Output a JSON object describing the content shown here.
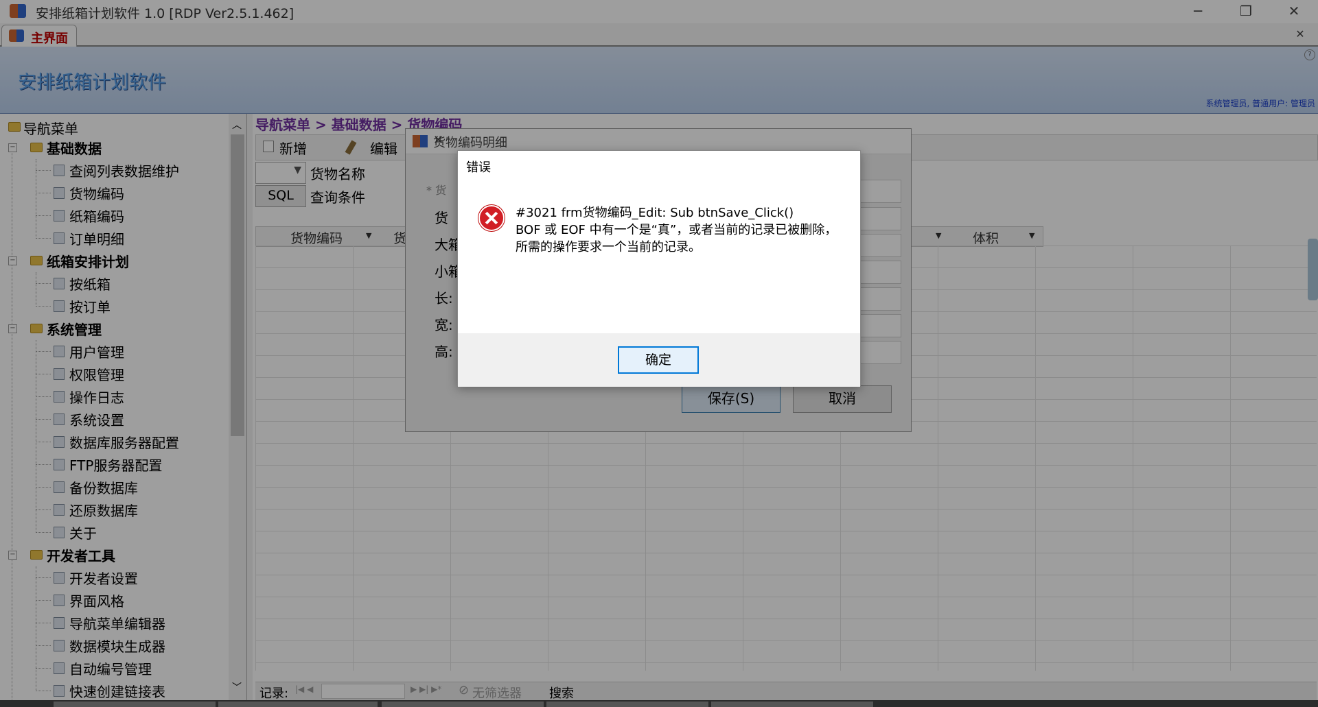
{
  "window": {
    "title": "安排纸箱计划软件 1.0 [RDP Ver2.5.1.462]",
    "minimize_glyph": "─",
    "maximize_glyph": "❐",
    "close_glyph": "✕"
  },
  "tabs": {
    "main_tab": "主界面",
    "close_glyph": "✕"
  },
  "banner": {
    "app_name": "安排纸箱计划软件",
    "user_info": "系统管理员, 普通用户: 管理员",
    "help_glyph": "?"
  },
  "sidebar": {
    "root": "导航菜单",
    "groups": [
      {
        "label": "基础数据",
        "items": [
          "查阅列表数据维护",
          "货物编码",
          "纸箱编码",
          "订单明细"
        ]
      },
      {
        "label": "纸箱安排计划",
        "items": [
          "按纸箱",
          "按订单"
        ]
      },
      {
        "label": "系统管理",
        "items": [
          "用户管理",
          "权限管理",
          "操作日志",
          "系统设置",
          "数据库服务器配置",
          "FTP服务器配置",
          "备份数据库",
          "还原数据库",
          "关于"
        ]
      },
      {
        "label": "开发者工具",
        "items": [
          "开发者设置",
          "界面风格",
          "导航菜单编辑器",
          "数据模块生成器",
          "自动编号管理",
          "快速创建链接表"
        ]
      }
    ]
  },
  "content": {
    "breadcrumb": "导航菜单 > 基础数据 > 货物编码",
    "toolbar": {
      "new_label": "新增",
      "edit_label": "编辑"
    },
    "filter": {
      "field_label": "货物名称",
      "sql_label": "SQL",
      "condition_label": "查询条件"
    },
    "grid": {
      "columns": [
        "货物编码",
        "货",
        "体积"
      ]
    },
    "navigator": {
      "record_label": "记录:",
      "no_filter": "无筛选器",
      "search_label": "搜索"
    }
  },
  "detail_dialog": {
    "title": "货物编码明细",
    "labels": [
      "* 货",
      "货",
      "大箱",
      "小箱",
      "长:",
      "宽:",
      "高:"
    ],
    "save_label": "保存(S)",
    "cancel_label": "取消"
  },
  "error_dialog": {
    "title": "错误",
    "line1": "#3021 frm货物编码_Edit: Sub btnSave_Click()",
    "line2": "BOF 或 EOF 中有一个是“真”，或者当前的记录已被删除，所需的操作要求一个当前的记录。",
    "ok_label": "确定"
  },
  "colors": {
    "breadcrumb": "#7030a0",
    "tab_text": "#c00000",
    "error_icon": "#d11e25",
    "ok_border": "#0078d7"
  }
}
